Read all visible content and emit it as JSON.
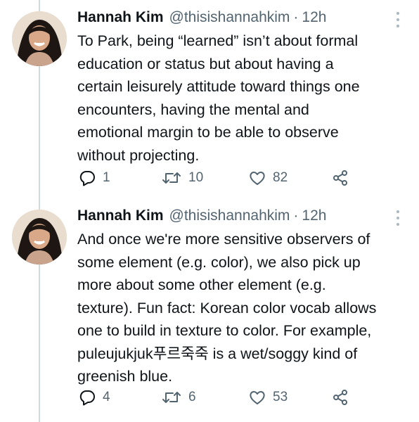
{
  "tweets": [
    {
      "author_name": "Hannah Kim",
      "handle": "@thisishannahkim",
      "separator": "·",
      "time": "12h",
      "text": "To Park, being “learned” isn’t about formal\neducation or status but about having a\ncertain leisurely attitude toward things one\nencounters, having the mental and\nemotional margin to be able to observe\nwithout projecting.",
      "reply_count": "1",
      "retweet_count": "10",
      "like_count": "82"
    },
    {
      "author_name": "Hannah Kim",
      "handle": "@thisishannahkim",
      "separator": "·",
      "time": "12h",
      "text": "And once we're more sensitive observers of\nsome element (e.g. color), we also pick up\nmore about some other element (e.g.\ntexture). Fun fact: Korean color vocab allows\none to build in texture to color. For example,\npuleujukjuk푸르죽죽 is a wet/soggy kind of\ngreenish blue.",
      "reply_count": "4",
      "retweet_count": "6",
      "like_count": "53"
    }
  ],
  "colors": {
    "text": "#0f1419",
    "secondary": "#536471",
    "thread_line": "#cfd9de"
  },
  "icons": [
    "reply-icon",
    "retweet-icon",
    "like-icon",
    "share-icon",
    "more-options-icon"
  ]
}
